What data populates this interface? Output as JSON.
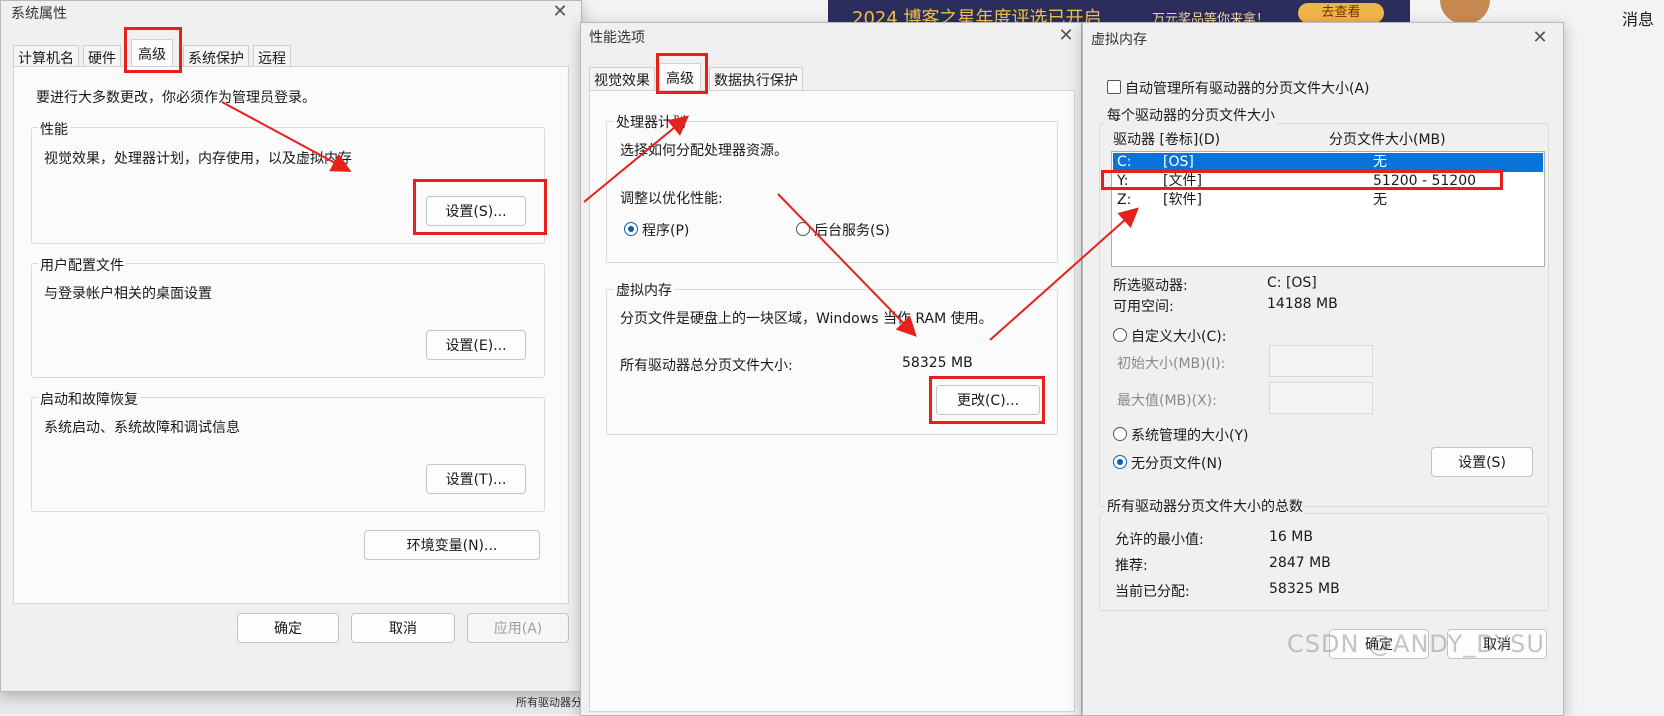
{
  "background": {
    "banner_text": "2024 博客之星年度评选已开启",
    "banner_sub": "万元奖品等你来拿！",
    "banner_button": "去查看",
    "right_edge_text": "消息",
    "bottom_fragment": "所有驱动器分页"
  },
  "sysprops": {
    "title": "系统属性",
    "tabs": [
      "计算机名",
      "硬件",
      "高级",
      "系统保护",
      "远程"
    ],
    "admin_note": "要进行大多数更改，你必须作为管理员登录。",
    "perf_group": "性能",
    "perf_desc": "视觉效果，处理器计划，内存使用，以及虚拟内存",
    "perf_button": "设置(S)...",
    "profile_group": "用户配置文件",
    "profile_desc": "与登录帐户相关的桌面设置",
    "profile_button": "设置(E)...",
    "startup_group": "启动和故障恢复",
    "startup_desc": "系统启动、系统故障和调试信息",
    "startup_button": "设置(T)...",
    "env_button": "环境变量(N)...",
    "ok": "确定",
    "cancel": "取消",
    "apply": "应用(A)"
  },
  "perfopts": {
    "title": "性能选项",
    "tabs": [
      "视觉效果",
      "高级",
      "数据执行保护"
    ],
    "sched_group": "处理器计划",
    "sched_desc": "选择如何分配处理器资源。",
    "adjust_label": "调整以优化性能:",
    "radio_programs": "程序(P)",
    "radio_services": "后台服务(S)",
    "vm_group": "虚拟内存",
    "vm_desc": "分页文件是硬盘上的一块区域，Windows 当作 RAM 使用。",
    "total_label": "所有驱动器总分页文件大小:",
    "total_value": "58325 MB",
    "change_button": "更改(C)..."
  },
  "vmem": {
    "title": "虚拟内存",
    "auto_manage": "自动管理所有驱动器的分页文件大小(A)",
    "per_drive_group": "每个驱动器的分页文件大小",
    "col_drive": "驱动器 [卷标](D)",
    "col_size": "分页文件大小(MB)",
    "drives": [
      {
        "letter": "C:",
        "label": "[OS]",
        "size": "无"
      },
      {
        "letter": "Y:",
        "label": "[文件]",
        "size": "51200 - 51200"
      },
      {
        "letter": "Z:",
        "label": "[软件]",
        "size": "无"
      }
    ],
    "selected_drive_label": "所选驱动器:",
    "selected_drive_value": "C:  [OS]",
    "free_space_label": "可用空间:",
    "free_space_value": "14188 MB",
    "custom_size": "自定义大小(C):",
    "initial_size": "初始大小(MB)(I):",
    "max_size": "最大值(MB)(X):",
    "system_managed": "系统管理的大小(Y)",
    "no_paging": "无分页文件(N)",
    "set_button": "设置(S)",
    "total_group": "所有驱动器分页文件大小的总数",
    "min_label": "允许的最小值:",
    "min_value": "16 MB",
    "rec_label": "推荐:",
    "rec_value": "2847 MB",
    "cur_label": "当前已分配:",
    "cur_value": "58325 MB",
    "ok": "确定",
    "cancel": "取消"
  },
  "watermark": "CSDN @ANDY_DYSU",
  "colors": {
    "annotation": "#e8201b",
    "selection": "#0a73d9",
    "dialog_bg": "#f0f0f0"
  }
}
